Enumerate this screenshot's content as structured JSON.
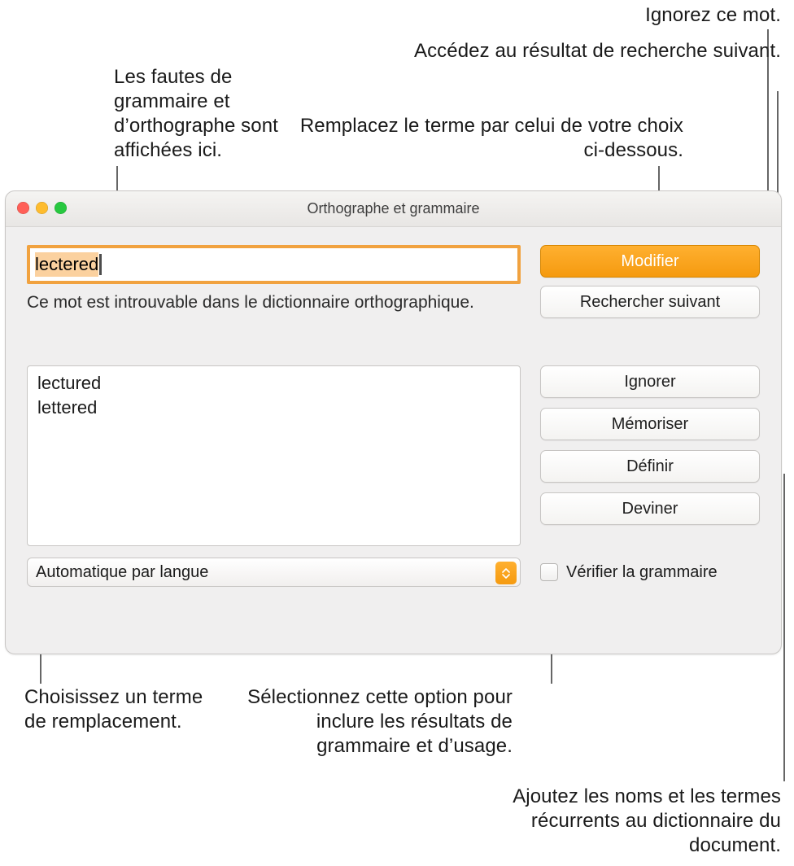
{
  "callouts": {
    "ignore": "Ignorez ce mot.",
    "next": "Accédez au résultat de recherche suivant.",
    "replace": "Remplacez le terme par celui de votre choix ci-dessous.",
    "errors": "Les fautes de grammaire et d’orthographe sont affichées ici.",
    "choose": "Choisissez un terme de remplacement.",
    "grammarOpt": "Sélectionnez cette option pour inclure les résultats de grammaire et d’usage.",
    "learn": "Ajoutez les noms et les termes récurrents au dictionnaire du document."
  },
  "window": {
    "title": "Orthographe et grammaire",
    "word": "lectered",
    "message": "Ce mot est introuvable dans le dictionnaire orthographique.",
    "suggestions": [
      "lectured",
      "lettered"
    ],
    "languageSelect": "Automatique par langue",
    "checkGrammarLabel": "Vérifier la grammaire",
    "buttons": {
      "modify": "Modifier",
      "findNext": "Rechercher suivant",
      "ignore": "Ignorer",
      "learn": "Mémoriser",
      "define": "Définir",
      "guess": "Deviner"
    }
  }
}
